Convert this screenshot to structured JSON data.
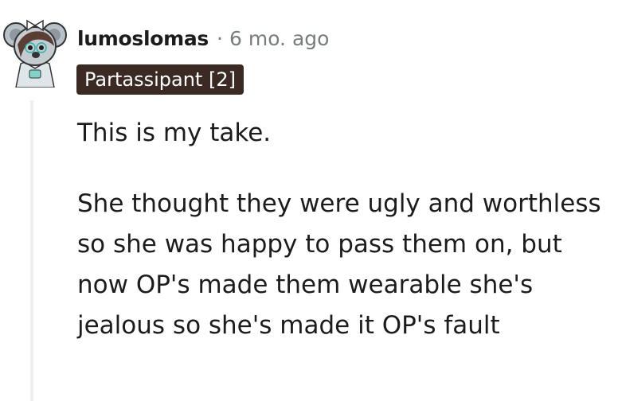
{
  "comment": {
    "username": "lumoslomas",
    "separator": "·",
    "timestamp": "6 mo. ago",
    "flair": "Partassipant [2]",
    "avatar_icon": "koala-avatar-icon",
    "paragraphs": [
      "This is my take.",
      "She thought they were ugly and worthless so she was happy to pass them on, but now OP's made them wearable she's jealous so she's made it OP's fault"
    ]
  },
  "colors": {
    "flair_background": "#3b2a23",
    "muted_text": "#787c7e",
    "thread_line": "#edeff1"
  }
}
